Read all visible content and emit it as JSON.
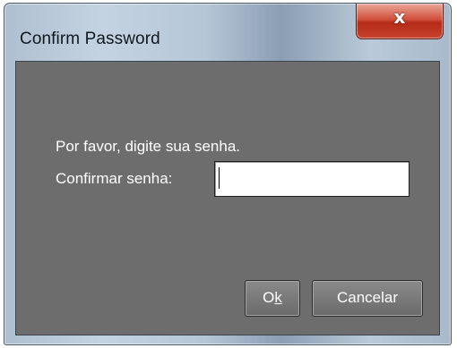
{
  "window": {
    "title": "Confirm Password",
    "close_icon": "close-icon",
    "close_glyph": "x"
  },
  "form": {
    "prompt": "Por favor, digite sua senha.",
    "confirm_label": "Confirmar senha:",
    "password_value": ""
  },
  "buttons": {
    "ok_label_before": "O",
    "ok_label_mnemonic": "k",
    "cancel_label": "Cancelar"
  },
  "colors": {
    "client_background": "#6d6d6d",
    "close_button": "#c9432d",
    "text": "#ffffff"
  }
}
